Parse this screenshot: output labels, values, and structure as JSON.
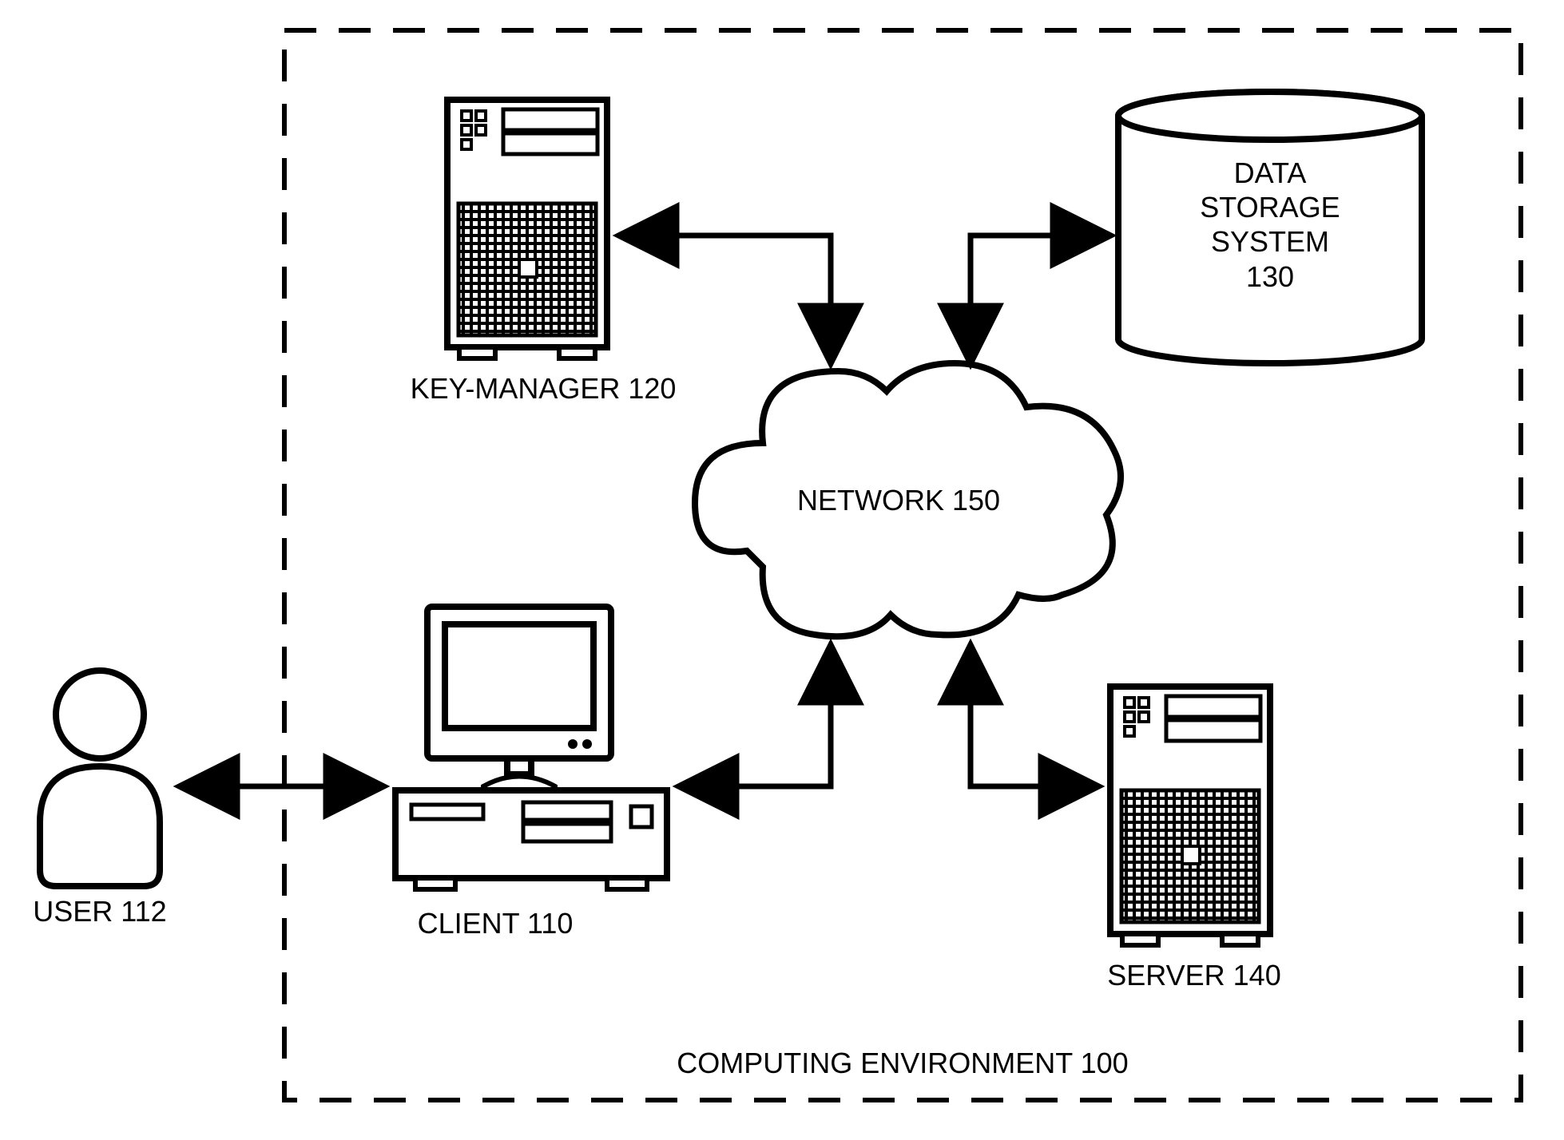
{
  "diagram": {
    "environment_label": "COMPUTING ENVIRONMENT 100",
    "user_label": "USER 112",
    "client_label": "CLIENT 110",
    "key_manager_label": "KEY-MANAGER 120",
    "server_label": "SERVER 140",
    "network_label": "NETWORK 150",
    "storage_label": "DATA\nSTORAGE\nSYSTEM\n130"
  },
  "nodes": [
    {
      "id": "user",
      "role": "actor",
      "label_ref": "diagram.user_label"
    },
    {
      "id": "client",
      "role": "computer",
      "label_ref": "diagram.client_label"
    },
    {
      "id": "key_manager",
      "role": "server",
      "label_ref": "diagram.key_manager_label"
    },
    {
      "id": "server",
      "role": "server",
      "label_ref": "diagram.server_label"
    },
    {
      "id": "network",
      "role": "cloud",
      "label_ref": "diagram.network_label"
    },
    {
      "id": "storage",
      "role": "database",
      "label_ref": "diagram.storage_label"
    },
    {
      "id": "environment",
      "role": "boundary",
      "label_ref": "diagram.environment_label"
    }
  ],
  "edges": [
    {
      "from": "user",
      "to": "client",
      "bidirectional": true
    },
    {
      "from": "client",
      "to": "network",
      "bidirectional": true
    },
    {
      "from": "key_manager",
      "to": "network",
      "bidirectional": true
    },
    {
      "from": "server",
      "to": "network",
      "bidirectional": true
    },
    {
      "from": "network",
      "to": "storage",
      "bidirectional": true
    }
  ]
}
